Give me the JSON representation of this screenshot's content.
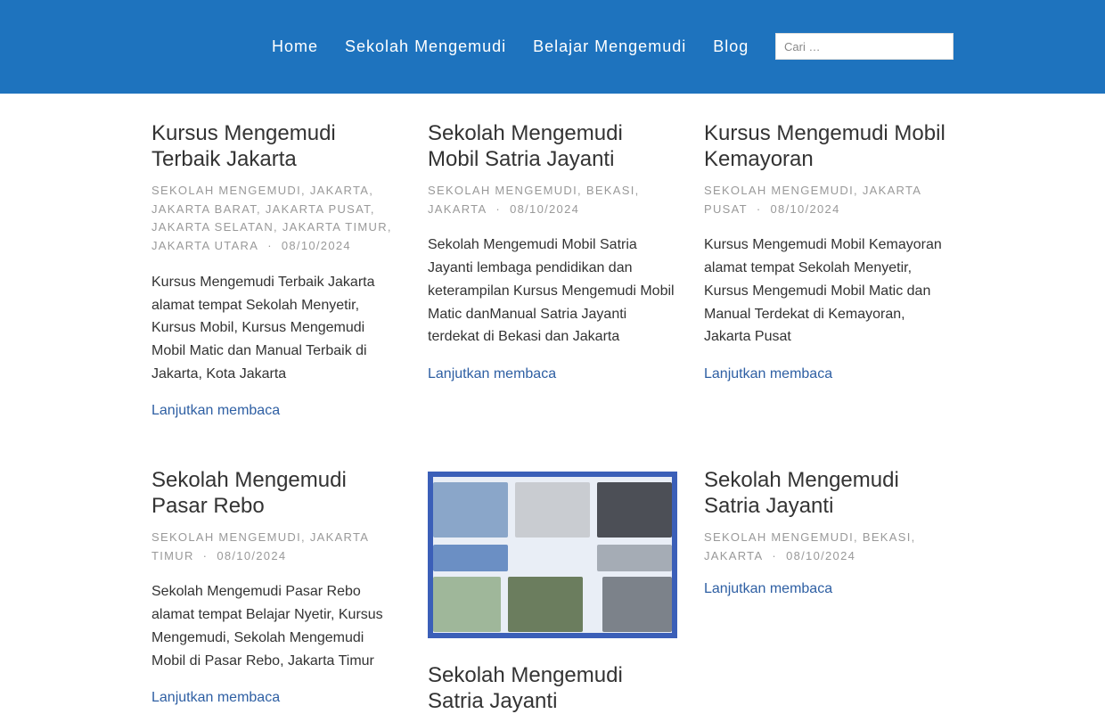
{
  "header": {
    "nav": [
      "Home",
      "Sekolah Mengemudi",
      "Belajar Mengemudi",
      "Blog"
    ],
    "search_placeholder": "Cari …"
  },
  "posts": [
    {
      "title": "Kursus Mengemudi Terbaik Jakarta",
      "categories": [
        "Sekolah Mengemudi",
        "Jakarta",
        "Jakarta Barat",
        "Jakarta Pusat",
        "Jakarta Selatan",
        "Jakarta Timur",
        "Jakarta Utara"
      ],
      "date": "08/10/2024",
      "excerpt": "Kursus Mengemudi Terbaik Jakarta alamat tempat Sekolah Menyetir, Kursus Mobil, Kursus Mengemudi Mobil Matic dan Manual Terbaik di Jakarta, Kota Jakarta",
      "more": "Lanjutkan membaca"
    },
    {
      "title": "Sekolah Mengemudi Mobil Satria Jayanti",
      "categories": [
        "Sekolah Mengemudi",
        "Bekasi",
        "Jakarta"
      ],
      "date": "08/10/2024",
      "excerpt": "Sekolah Mengemudi Mobil Satria Jayanti lembaga pendidikan dan keterampilan Kursus Mengemudi Mobil Matic danManual Satria Jayanti terdekat di Bekasi dan Jakarta",
      "more": "Lanjutkan membaca"
    },
    {
      "title": "Kursus Mengemudi Mobil Kemayoran",
      "categories": [
        "Sekolah Mengemudi",
        "Jakarta Pusat"
      ],
      "date": "08/10/2024",
      "excerpt": "Kursus Mengemudi Mobil Kemayoran alamat tempat Sekolah Menyetir, Kursus Mengemudi Mobil Matic dan Manual Terdekat di Kemayoran, Jakarta Pusat",
      "more": "Lanjutkan membaca"
    },
    {
      "title": "Sekolah Mengemudi Pasar Rebo",
      "categories": [
        "Sekolah Mengemudi",
        "Jakarta Timur"
      ],
      "date": "08/10/2024",
      "excerpt": "Sekolah Mengemudi Pasar Rebo alamat tempat Belajar Nyetir, Kursus Mengemudi, Sekolah Mengemudi Mobil di Pasar Rebo, Jakarta Timur",
      "more": "Lanjutkan membaca"
    },
    {
      "title": "Sekolah Mengemudi Satria Jayanti",
      "categories": [],
      "date": "",
      "excerpt": "",
      "more": ""
    },
    {
      "title": "Sekolah Mengemudi Satria Jayanti",
      "categories": [
        "Sekolah Mengemudi",
        "Bekasi",
        "Jakarta"
      ],
      "date": "08/10/2024",
      "excerpt": "",
      "more": "Lanjutkan membaca"
    }
  ],
  "colors": {
    "header_bg": "#1e73be",
    "link": "#2e5fa3",
    "meta": "#999999"
  }
}
